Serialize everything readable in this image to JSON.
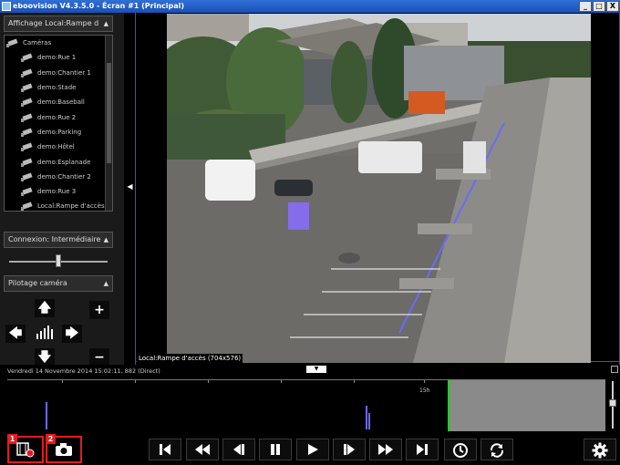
{
  "window": {
    "title": "eboovision V4.3.5.0 - Écran #1 (Principal)",
    "buttons": [
      "_",
      "□",
      "X"
    ]
  },
  "left_panel": {
    "display_label": "Affichage  Local:Rampe d",
    "tree": {
      "root": "Caméras",
      "items": [
        "demo:Rue 1",
        "demo:Chantier 1",
        "demo:Stade",
        "demo:Baseball",
        "demo:Rue 2",
        "demo:Parking",
        "demo:Hôtel",
        "demo:Esplanade",
        "demo:Chantier 2",
        "demo:Rue 3",
        "Local:Rampe d'accès"
      ]
    },
    "connection_label": "Connexion: Intermédiaire",
    "connection_slider_level": 0.5,
    "ptz_label": "Pilotage caméra",
    "ptz_buttons": {
      "up": "🡅",
      "left": "🡄",
      "right": "🡆",
      "down": "🡇",
      "plus": "+",
      "minus": "−"
    }
  },
  "video": {
    "caption": "Local:Rampe d'accès (704x576)"
  },
  "timeline": {
    "datetime": "Vendredi 14 Novembre 2014     15:02:11, 882     (Direct)",
    "hour_label": "15h"
  },
  "toolbar": {
    "badges": [
      "1",
      "2"
    ],
    "icons": [
      "video-record-icon",
      "camera-snapshot-icon",
      "skip-start-icon",
      "rewind-icon",
      "step-back-icon",
      "pause-icon",
      "play-icon",
      "step-forward-icon",
      "fast-forward-icon",
      "skip-end-icon",
      "clock-icon",
      "sync-icon",
      "settings-gear-icon"
    ]
  },
  "colors": {
    "highlight": "#e41c1c",
    "timeline_marker": "#22cc22",
    "video_border": "#4848c8"
  }
}
